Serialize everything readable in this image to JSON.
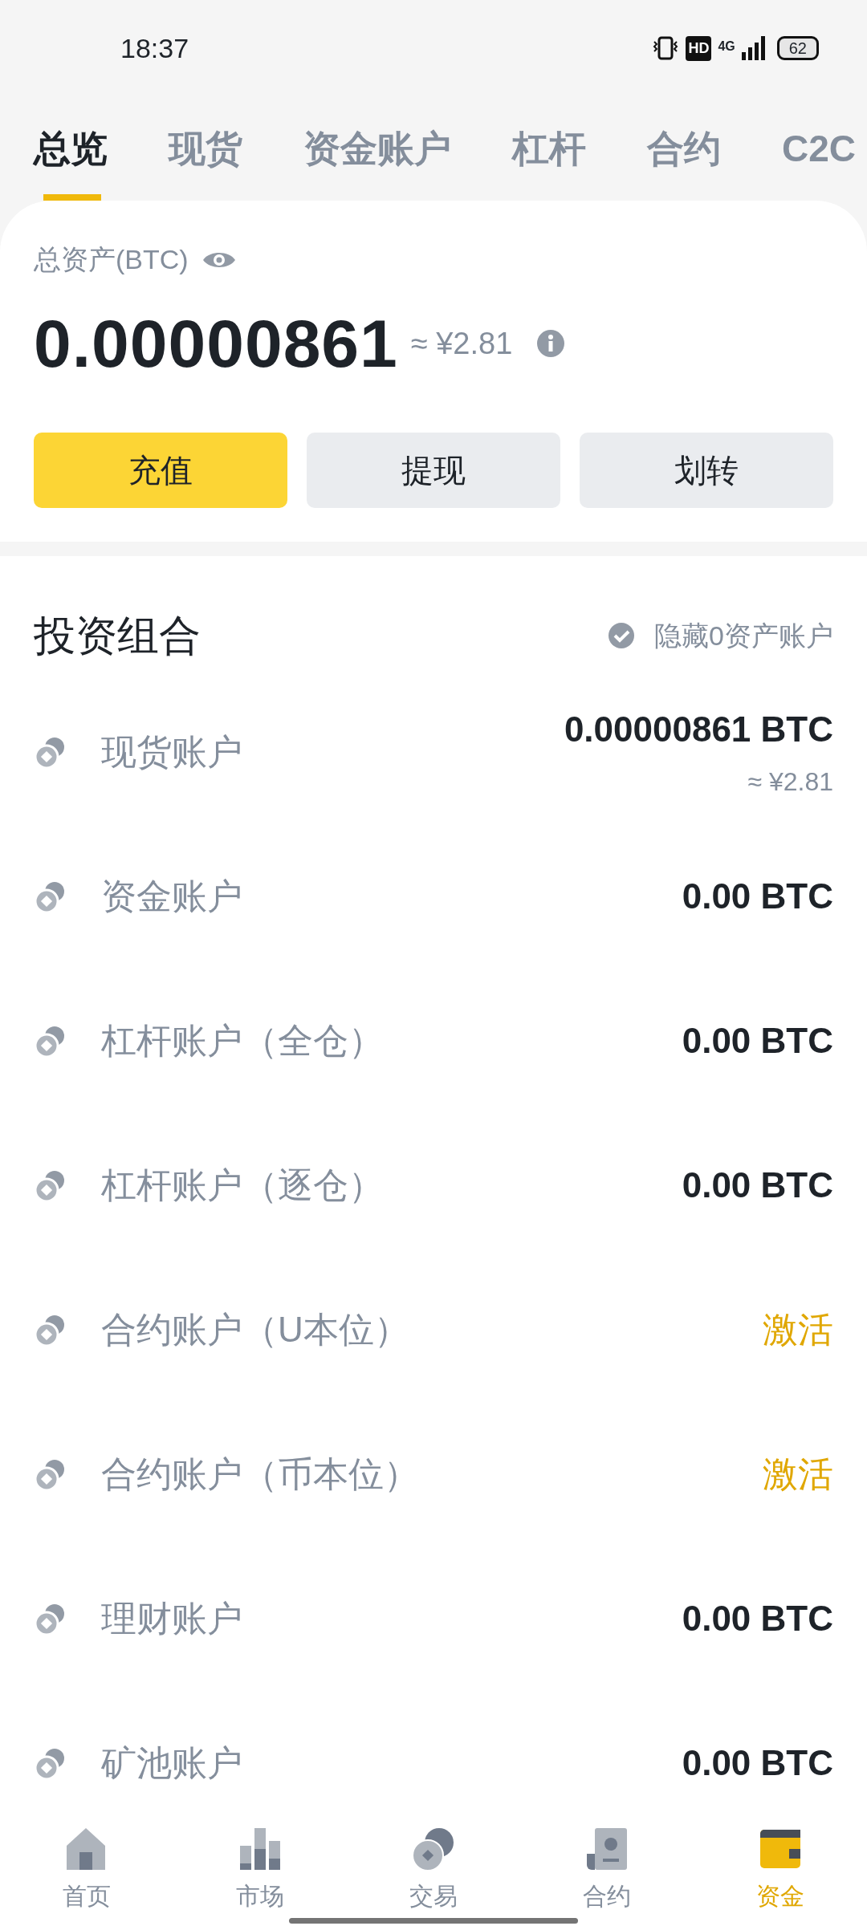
{
  "status_bar": {
    "time": "18:37",
    "hd": "HD",
    "network": "4G",
    "battery": "62"
  },
  "tabs": [
    {
      "label": "总览",
      "selected": true
    },
    {
      "label": "现货",
      "selected": false
    },
    {
      "label": "资金账户",
      "selected": false
    },
    {
      "label": "杠杆",
      "selected": false
    },
    {
      "label": "合约",
      "selected": false
    },
    {
      "label": "C2C",
      "selected": false
    }
  ],
  "summary": {
    "label": "总资产(BTC)",
    "amount": "0.00000861",
    "approx": "≈ ¥2.81"
  },
  "buttons": [
    {
      "label": "充值",
      "primary": true
    },
    {
      "label": "提现",
      "primary": false
    },
    {
      "label": "划转",
      "primary": false
    }
  ],
  "portfolio": {
    "title": "投资组合",
    "hide_zero": {
      "label": "隐藏0资产账户",
      "checked": false
    }
  },
  "accounts": [
    {
      "name": "现货账户",
      "kind": "balance",
      "value": "0.00000861 BTC",
      "sub": "≈ ¥2.81"
    },
    {
      "name": "资金账户",
      "kind": "balance",
      "value": "0.00 BTC"
    },
    {
      "name": "杠杆账户（全仓）",
      "kind": "balance",
      "value": "0.00 BTC"
    },
    {
      "name": "杠杆账户（逐仓）",
      "kind": "balance",
      "value": "0.00 BTC"
    },
    {
      "name": "合约账户（U本位）",
      "kind": "action",
      "value": "激活"
    },
    {
      "name": "合约账户（币本位）",
      "kind": "action",
      "value": "激活"
    },
    {
      "name": "理财账户",
      "kind": "balance",
      "value": "0.00 BTC"
    },
    {
      "name": "矿池账户",
      "kind": "balance",
      "value": "0.00 BTC"
    }
  ],
  "bottom_nav": [
    {
      "label": "首页",
      "selected": false
    },
    {
      "label": "市场",
      "selected": false
    },
    {
      "label": "交易",
      "selected": false
    },
    {
      "label": "合约",
      "selected": false
    },
    {
      "label": "资金",
      "selected": true
    }
  ]
}
